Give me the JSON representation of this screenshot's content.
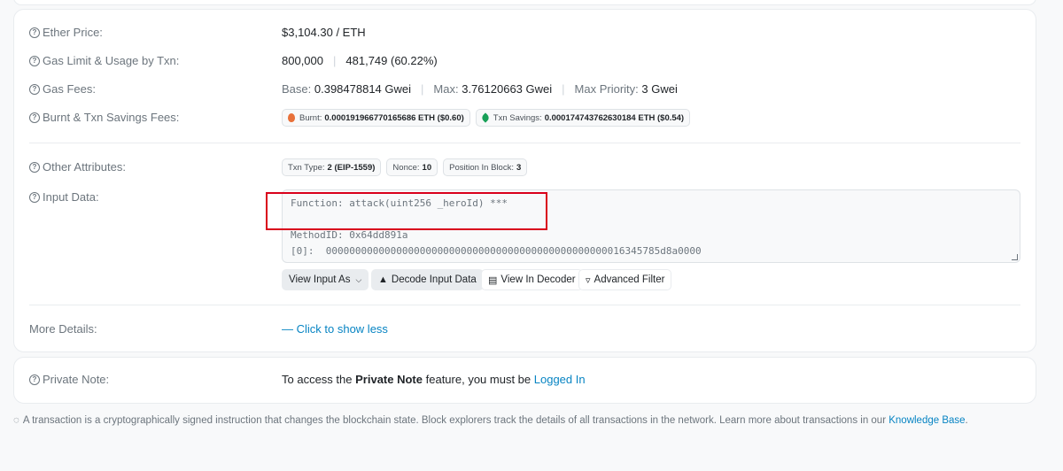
{
  "details": {
    "ether_price": {
      "label": "Ether Price:",
      "value": "$3,104.30 / ETH"
    },
    "gas_limit": {
      "label": "Gas Limit & Usage by Txn:",
      "limit": "800,000",
      "separator": "|",
      "usage": "481,749 (60.22%)"
    },
    "gas_fees": {
      "label": "Gas Fees:",
      "base_label": "Base:",
      "base_value": "0.398478814 Gwei",
      "max_label": "Max:",
      "max_value": "3.76120663 Gwei",
      "priority_label": "Max Priority:",
      "priority_value": "3 Gwei",
      "separator": "|"
    },
    "burnt_fees": {
      "label": "Burnt & Txn Savings Fees:",
      "burnt_label": "Burnt:",
      "burnt_value": "0.000191966770165686 ETH ($0.60)",
      "savings_label": "Txn Savings:",
      "savings_value": "0.000174743762630184 ETH ($0.54)"
    },
    "other_attributes": {
      "label": "Other Attributes:",
      "txn_type_label": "Txn Type:",
      "txn_type_value": "2 (EIP-1559)",
      "nonce_label": "Nonce:",
      "nonce_value": "10",
      "position_label": "Position In Block:",
      "position_value": "3"
    },
    "input_data": {
      "label": "Input Data:",
      "function_line": "Function: attack(uint256 _heroId) ***",
      "method_line": "MethodID: 0x64dd891a",
      "param_line": "[0]:  000000000000000000000000000000000000000000000000016345785d8a0000",
      "buttons": {
        "view_input_as": "View Input As",
        "decode_input_data": "Decode Input Data",
        "view_in_decoder": "View In Decoder",
        "advanced_filter": "Advanced Filter"
      }
    },
    "more_details": {
      "label": "More Details:",
      "link": "— Click to show less"
    }
  },
  "private_note": {
    "label": "Private Note:",
    "text_before": "To access the",
    "bold": "Private Note",
    "text_middle": "feature, you must be",
    "link": "Logged In"
  },
  "footer": {
    "text": "A transaction is a cryptographically signed instruction that changes the blockchain state. Block explorers track the details of all transactions in the network. Learn more about transactions in our",
    "link": "Knowledge Base",
    "end": "."
  },
  "colors": {
    "link": "#0784c3",
    "highlight": "#d9001b"
  }
}
